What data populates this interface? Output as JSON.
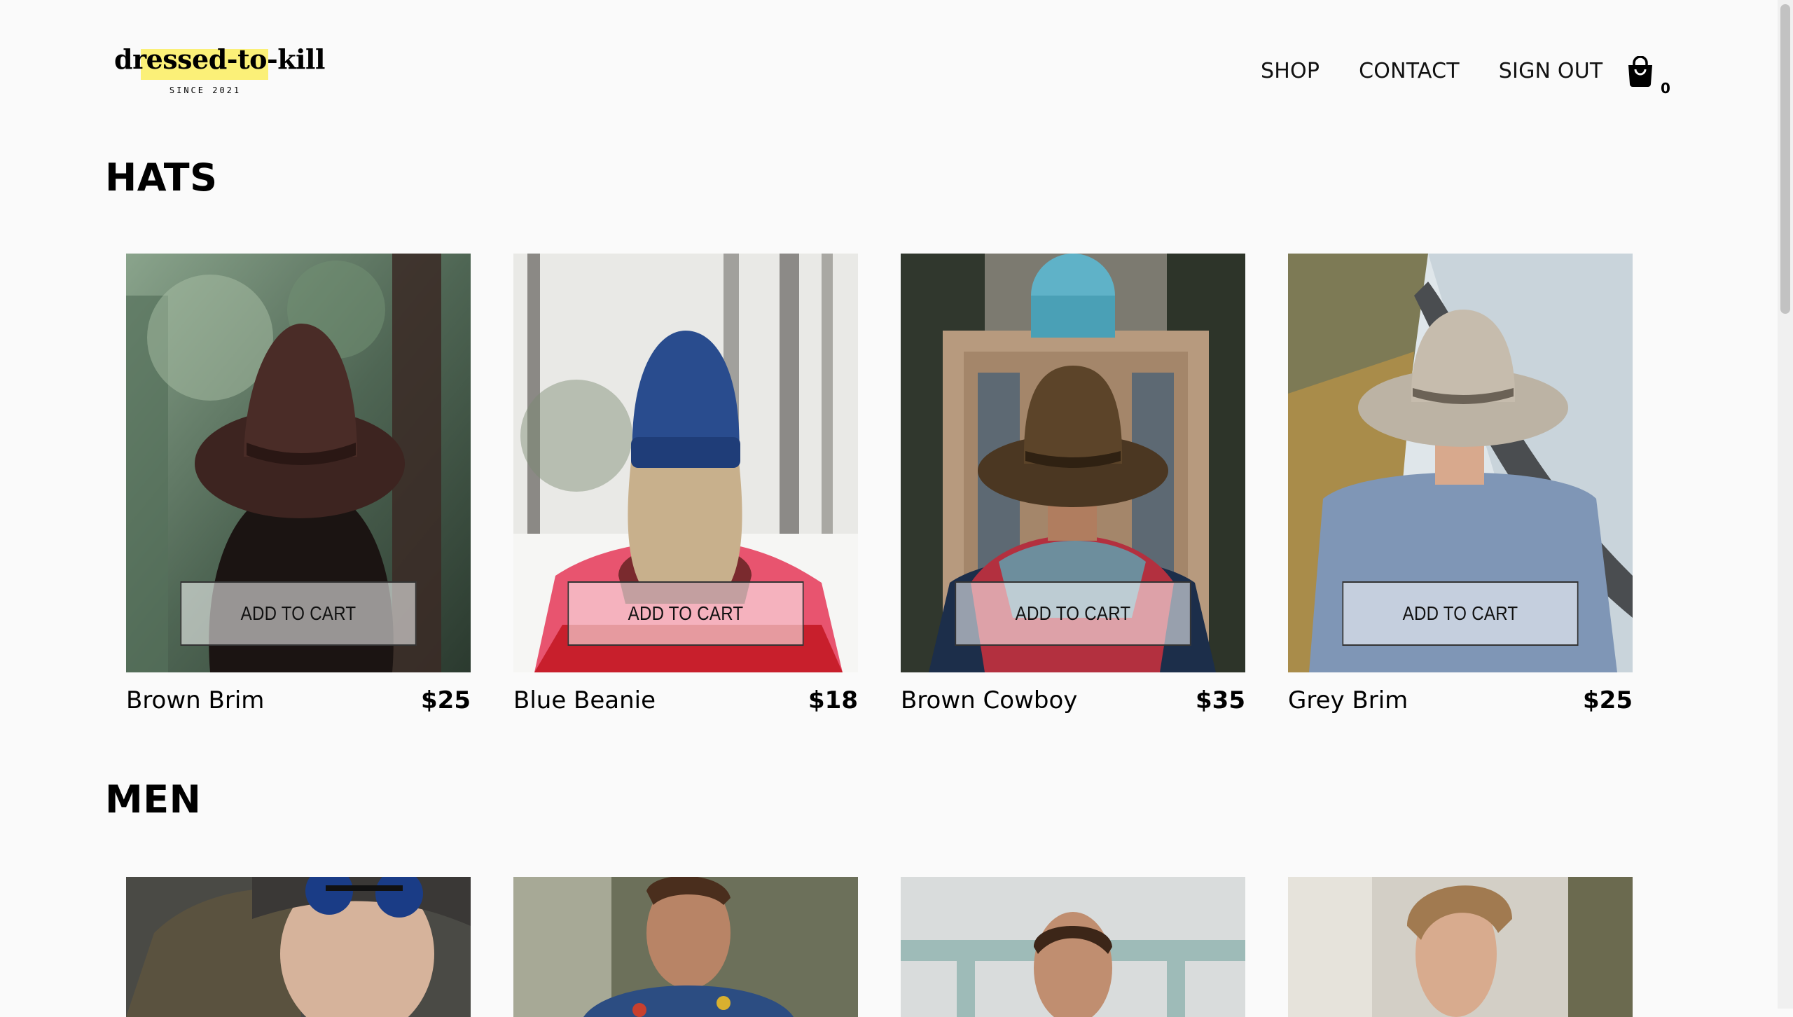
{
  "brand": {
    "name": "dressed-to-kill",
    "tagline": "SINCE 2021"
  },
  "nav": {
    "shop": "SHOP",
    "contact": "CONTACT",
    "sign_out": "SIGN OUT",
    "cart_count": "0",
    "cart_icon": "shopping-bag-icon"
  },
  "sections": {
    "hats": {
      "title": "HATS",
      "items": [
        {
          "name": "Brown Brim",
          "price": "$25",
          "button": "ADD TO CART"
        },
        {
          "name": "Blue Beanie",
          "price": "$18",
          "button": "ADD TO CART"
        },
        {
          "name": "Brown Cowboy",
          "price": "$35",
          "button": "ADD TO CART"
        },
        {
          "name": "Grey Brim",
          "price": "$25",
          "button": "ADD TO CART"
        }
      ]
    },
    "men": {
      "title": "MEN"
    }
  },
  "colors": {
    "background": "#fafafa",
    "logo_highlight": "#fbf078",
    "text": "#000000"
  }
}
